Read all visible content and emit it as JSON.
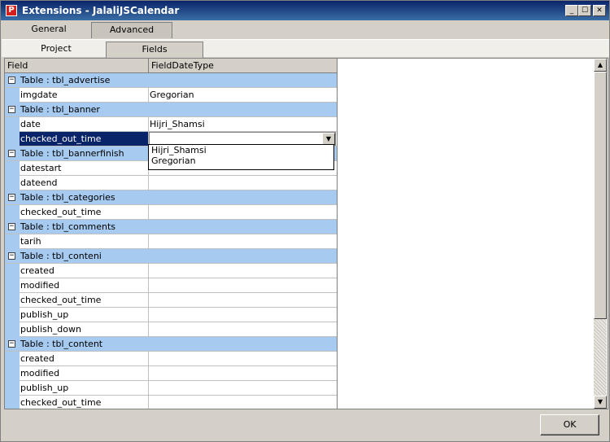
{
  "window": {
    "app_icon_letter": "P",
    "title": "Extensions - JalaliJSCalendar",
    "min_symbol": "_",
    "max_symbol": "☐",
    "close_symbol": "✕"
  },
  "tabs": [
    {
      "label": "General"
    },
    {
      "label": "Advanced"
    }
  ],
  "subtabs": [
    {
      "label": "Project"
    },
    {
      "label": "Fields"
    }
  ],
  "grid": {
    "columns": [
      "Field",
      "FieldDateType"
    ],
    "rows": [
      {
        "kind": "group",
        "label": "Table : tbl_advertise"
      },
      {
        "kind": "field",
        "field": "imgdate",
        "type": "Gregorian"
      },
      {
        "kind": "group",
        "label": "Table : tbl_banner"
      },
      {
        "kind": "field",
        "field": "date",
        "type": "Hijri_Shamsi"
      },
      {
        "kind": "field",
        "field": "checked_out_time",
        "type": "",
        "selected": true,
        "editing": true
      },
      {
        "kind": "group",
        "label": "Table : tbl_bannerfinish"
      },
      {
        "kind": "field",
        "field": "datestart",
        "type": ""
      },
      {
        "kind": "field",
        "field": "dateend",
        "type": ""
      },
      {
        "kind": "group",
        "label": "Table : tbl_categories"
      },
      {
        "kind": "field",
        "field": "checked_out_time",
        "type": ""
      },
      {
        "kind": "group",
        "label": "Table : tbl_comments"
      },
      {
        "kind": "field",
        "field": "tarih",
        "type": ""
      },
      {
        "kind": "group",
        "label": "Table : tbl_conteni"
      },
      {
        "kind": "field",
        "field": "created",
        "type": ""
      },
      {
        "kind": "field",
        "field": "modified",
        "type": ""
      },
      {
        "kind": "field",
        "field": "checked_out_time",
        "type": ""
      },
      {
        "kind": "field",
        "field": "publish_up",
        "type": ""
      },
      {
        "kind": "field",
        "field": "publish_down",
        "type": ""
      },
      {
        "kind": "group",
        "label": "Table : tbl_content"
      },
      {
        "kind": "field",
        "field": "created",
        "type": ""
      },
      {
        "kind": "field",
        "field": "modified",
        "type": ""
      },
      {
        "kind": "field",
        "field": "publish_up",
        "type": ""
      },
      {
        "kind": "field",
        "field": "checked_out_time",
        "type": ""
      }
    ],
    "expander_symbol": "−"
  },
  "dropdown": {
    "options": [
      "Hijri_Shamsi",
      "Gregorian"
    ],
    "arrow": "▼"
  },
  "scrollbar": {
    "up_arrow": "▲",
    "down_arrow": "▼"
  },
  "footer": {
    "ok_label": "OK"
  },
  "colors": {
    "titlebar": "#0a246a",
    "group_row": "#a6caf0",
    "selection": "#0a246a",
    "chrome": "#d4d0c8"
  }
}
